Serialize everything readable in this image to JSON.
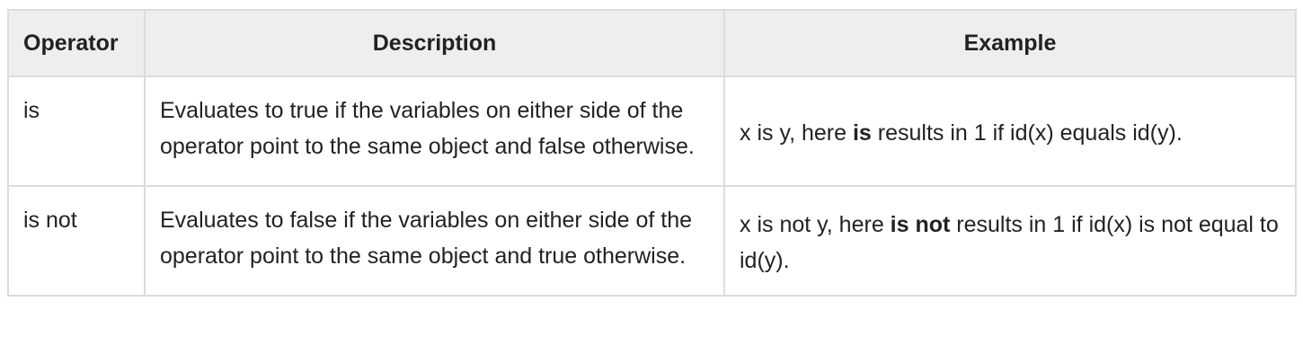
{
  "table": {
    "headers": [
      "Operator",
      "Description",
      "Example"
    ],
    "rows": [
      {
        "operator": "is",
        "description": "Evaluates to true if the variables on either side of the operator point to the same object and false otherwise.",
        "example_pre": "x is y, here ",
        "example_bold": "is",
        "example_post": " results in 1 if id(x) equals id(y)."
      },
      {
        "operator": "is not",
        "description": "Evaluates to false if the variables on either side of the operator point to the same object and true otherwise.",
        "example_pre": "x is not y, here ",
        "example_bold": "is not",
        "example_post": " results in 1 if id(x) is not equal to id(y)."
      }
    ]
  }
}
